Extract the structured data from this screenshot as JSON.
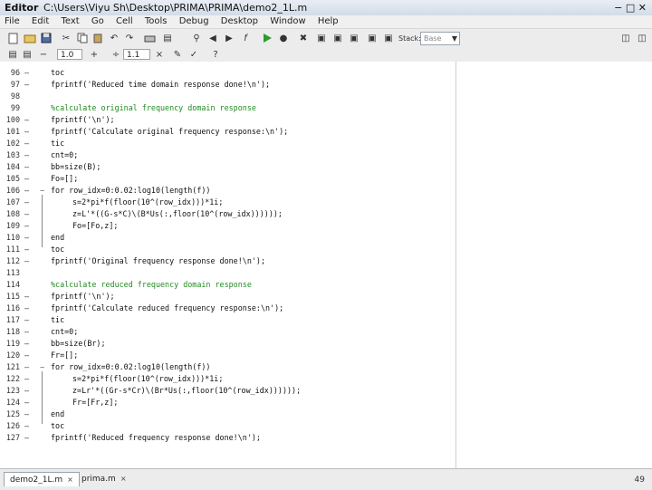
{
  "window": {
    "app_name": "Editor",
    "path": "C:\\Users\\Viyu Sh\\Desktop\\PRIMA\\PRIMA\\demo2_1L.m",
    "controls": "− □ ✕"
  },
  "menu": [
    "File",
    "Edit",
    "Text",
    "Go",
    "Cell",
    "Tools",
    "Debug",
    "Desktop",
    "Window",
    "Help"
  ],
  "toolbar": {
    "stack_label": "Stack:",
    "stack_value": "Base",
    "cell_minus": "−",
    "cell_value1": "1.0",
    "cell_plus": "+",
    "cell_divide": "÷",
    "cell_value2": "1.1",
    "cell_times": "×",
    "help_label": "?"
  },
  "code_lines": [
    {
      "num": "96",
      "dash": "—",
      "fold": "",
      "text": "toc",
      "kind": "code"
    },
    {
      "num": "97",
      "dash": "—",
      "fold": "",
      "text": "fprintf('Reduced time domain response done!\\n');",
      "kind": "code"
    },
    {
      "num": "98",
      "dash": "",
      "fold": "",
      "text": "",
      "kind": "code"
    },
    {
      "num": "99",
      "dash": "",
      "fold": "",
      "text": "%calculate original frequency domain response",
      "kind": "comment"
    },
    {
      "num": "100",
      "dash": "—",
      "fold": "",
      "text": "fprintf('\\n');",
      "kind": "code"
    },
    {
      "num": "101",
      "dash": "—",
      "fold": "",
      "text": "fprintf('Calculate original frequency response:\\n');",
      "kind": "code"
    },
    {
      "num": "102",
      "dash": "—",
      "fold": "",
      "text": "tic",
      "kind": "code"
    },
    {
      "num": "103",
      "dash": "—",
      "fold": "",
      "text": "cnt=0;",
      "kind": "code"
    },
    {
      "num": "104",
      "dash": "—",
      "fold": "",
      "text": "bb=size(B);",
      "kind": "code"
    },
    {
      "num": "105",
      "dash": "—",
      "fold": "",
      "text": "Fo=[];",
      "kind": "code"
    },
    {
      "num": "106",
      "dash": "—",
      "fold": "−",
      "text": "for row_idx=0:0.02:log10(length(f))",
      "kind": "code"
    },
    {
      "num": "107",
      "dash": "—",
      "fold": "",
      "text": "s=2*pi*f(floor(10^(row_idx)))*1i;",
      "kind": "indent"
    },
    {
      "num": "108",
      "dash": "—",
      "fold": "",
      "text": "z=L'*((G-s*C)\\(B*Us(:,floor(10^(row_idx))))));",
      "kind": "indent"
    },
    {
      "num": "109",
      "dash": "—",
      "fold": "",
      "text": "Fo=[Fo,z];",
      "kind": "indent"
    },
    {
      "num": "110",
      "dash": "—",
      "fold": "",
      "text": "end",
      "kind": "code"
    },
    {
      "num": "111",
      "dash": "—",
      "fold": "",
      "text": "toc",
      "kind": "code"
    },
    {
      "num": "112",
      "dash": "—",
      "fold": "",
      "text": "fprintf('Original frequency response done!\\n');",
      "kind": "code"
    },
    {
      "num": "113",
      "dash": "",
      "fold": "",
      "text": "",
      "kind": "code"
    },
    {
      "num": "114",
      "dash": "",
      "fold": "",
      "text": "%calculate reduced frequency domain response",
      "kind": "comment"
    },
    {
      "num": "115",
      "dash": "—",
      "fold": "",
      "text": "fprintf('\\n');",
      "kind": "code"
    },
    {
      "num": "116",
      "dash": "—",
      "fold": "",
      "text": "fprintf('Calculate reduced frequency response:\\n');",
      "kind": "code"
    },
    {
      "num": "117",
      "dash": "—",
      "fold": "",
      "text": "tic",
      "kind": "code"
    },
    {
      "num": "118",
      "dash": "—",
      "fold": "",
      "text": "cnt=0;",
      "kind": "code"
    },
    {
      "num": "119",
      "dash": "—",
      "fold": "",
      "text": "bb=size(Br);",
      "kind": "code"
    },
    {
      "num": "120",
      "dash": "—",
      "fold": "",
      "text": "Fr=[];",
      "kind": "code"
    },
    {
      "num": "121",
      "dash": "—",
      "fold": "−",
      "text": "for row_idx=0:0.02:log10(length(f))",
      "kind": "code"
    },
    {
      "num": "122",
      "dash": "—",
      "fold": "",
      "text": "s=2*pi*f(floor(10^(row_idx)))*1i;",
      "kind": "indent"
    },
    {
      "num": "123",
      "dash": "—",
      "fold": "",
      "text": "z=Lr'*((Gr-s*Cr)\\(Br*Us(:,floor(10^(row_idx))))));",
      "kind": "indent"
    },
    {
      "num": "124",
      "dash": "—",
      "fold": "",
      "text": "Fr=[Fr,z];",
      "kind": "indent"
    },
    {
      "num": "125",
      "dash": "—",
      "fold": "",
      "text": "end",
      "kind": "code"
    },
    {
      "num": "126",
      "dash": "—",
      "fold": "",
      "text": "toc",
      "kind": "code"
    },
    {
      "num": "127",
      "dash": "—",
      "fold": "",
      "text": "fprintf('Reduced frequency response done!\\n');",
      "kind": "code"
    }
  ],
  "tabs": [
    {
      "label": "demo2_1L.m",
      "close": "×"
    },
    {
      "label": "prima.m",
      "close": "×"
    }
  ],
  "page_number": "49",
  "colors": {
    "comment": "#228b22",
    "code": "#111111",
    "toolbar": "#ececec"
  }
}
